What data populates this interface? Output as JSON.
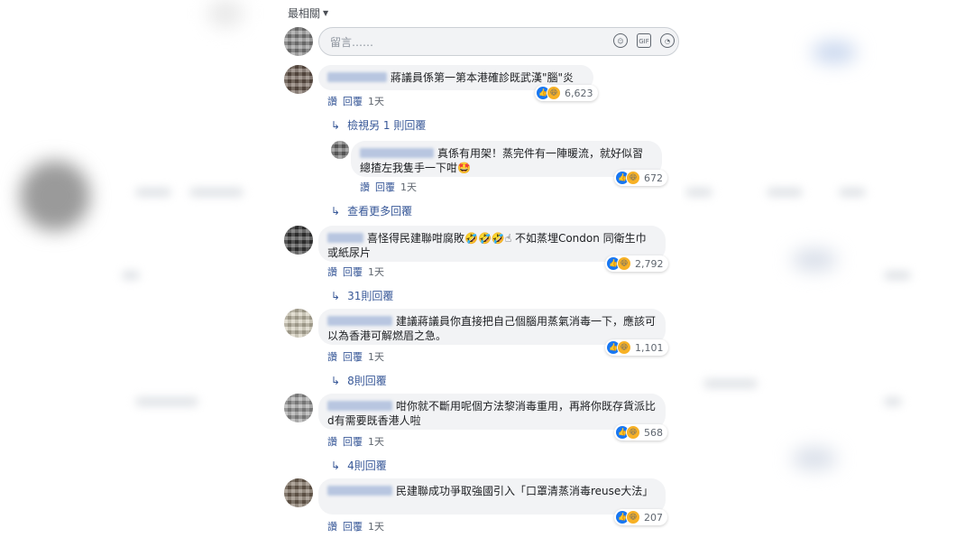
{
  "sort_label": "最相關",
  "composer": {
    "placeholder": "留言……",
    "gif": "GIF"
  },
  "actions": {
    "like": "讚",
    "reply": "回覆",
    "time": "1天"
  },
  "comments": [
    {
      "text": "蔣議員係第一第本港確診既武漢\"腦\"炎",
      "reactions": "6,623",
      "replies_link": "檢視另 1 則回覆"
    },
    {
      "text": "真係有用架！蒸完件有一陣暖流，就好似習總揸左我隻手一下咁🤩",
      "reactions": "672",
      "replies_link": "查看更多回覆"
    },
    {
      "text": "喜怪得民建聯咁腐敗🤣🤣🤣☝ 不如蒸埋Condon 同衛生巾或紙尿片",
      "reactions": "2,792",
      "replies_link": "31則回覆"
    },
    {
      "text": "建議蔣議員你直接把自己個腦用蒸氣消毒一下，應該可以為香港可解燃眉之急。",
      "reactions": "1,101",
      "replies_link": "8則回覆"
    },
    {
      "text": "咁你就不斷用呢個方法黎消毒重用，再將你既存貨派比d有需要既香港人啦",
      "reactions": "568",
      "replies_link": "4則回覆"
    },
    {
      "text": "民建聯成功爭取強國引入「口罩清蒸消毒reuse大法」",
      "reactions": "207"
    }
  ]
}
